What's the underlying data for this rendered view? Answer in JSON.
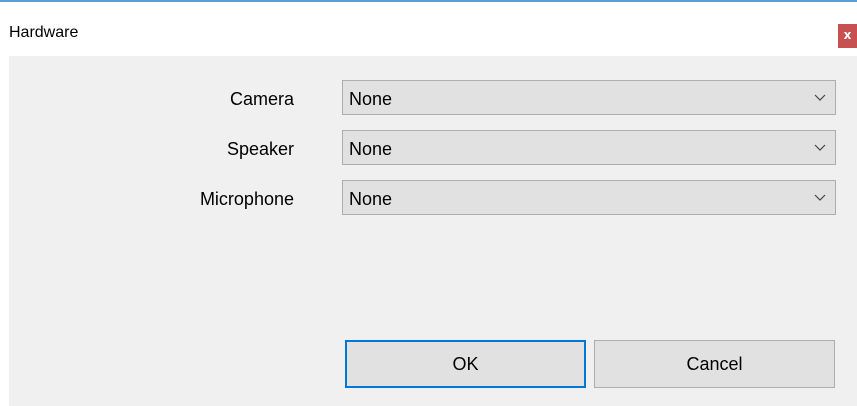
{
  "window": {
    "title": "Hardware",
    "close_glyph": "x"
  },
  "fields": [
    {
      "label": "Camera",
      "value": "None"
    },
    {
      "label": "Speaker",
      "value": "None"
    },
    {
      "label": "Microphone",
      "value": "None"
    }
  ],
  "buttons": {
    "ok_label": "OK",
    "cancel_label": "Cancel"
  },
  "colors": {
    "accent": "#0078d7",
    "close": "#c75050",
    "client_bg": "#f0f0f0"
  },
  "icons": {
    "dropdown": "chevron-down-icon",
    "close": "close-icon"
  }
}
